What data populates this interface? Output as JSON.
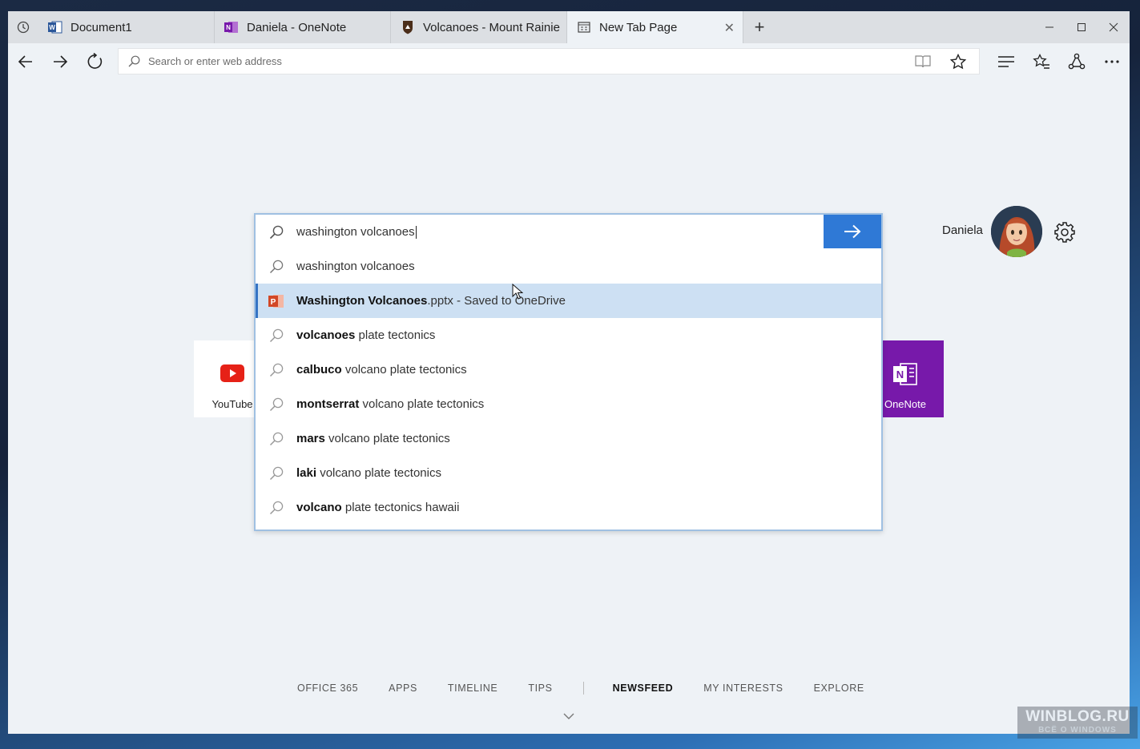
{
  "tabs": [
    {
      "title": "Document1",
      "icon": "word-icon",
      "active": false
    },
    {
      "title": "Daniela - OneNote",
      "icon": "onenote-icon",
      "active": false
    },
    {
      "title": "Volcanoes - Mount Rainie",
      "icon": "nps-icon",
      "active": false
    },
    {
      "title": "New Tab Page",
      "icon": "newtab-icon",
      "active": true
    }
  ],
  "addressbar": {
    "placeholder": "Search or enter web address"
  },
  "search": {
    "query": "washington volcanoes",
    "suggestions": [
      {
        "bold": "",
        "rest": "washington volcanoes",
        "icon": "search-icon"
      },
      {
        "bold": "Washington Volcanoes",
        "rest": ".pptx - Saved to OneDrive",
        "icon": "powerpoint-icon",
        "highlight": true
      },
      {
        "bold": "volcanoes",
        "rest": " plate tectonics",
        "icon": "search-icon"
      },
      {
        "bold": "calbuco",
        "rest": " volcano plate tectonics",
        "icon": "search-icon"
      },
      {
        "bold": "montserrat",
        "rest": " volcano plate tectonics",
        "icon": "search-icon"
      },
      {
        "bold": "mars",
        "rest": " volcano plate tectonics",
        "icon": "search-icon"
      },
      {
        "bold": "laki",
        "rest": " volcano plate tectonics",
        "icon": "search-icon"
      },
      {
        "bold": "volcano",
        "rest": " plate tectonics hawaii",
        "icon": "search-icon"
      }
    ]
  },
  "user": {
    "name": "Daniela"
  },
  "tiles": {
    "youtube": "YouTube",
    "onenote": "OneNote"
  },
  "bottom_nav": {
    "office365": "OFFICE 365",
    "apps": "APPS",
    "timeline": "TIMELINE",
    "tips": "TIPS",
    "newsfeed": "NEWSFEED",
    "interests": "MY INTERESTS",
    "explore": "EXPLORE"
  },
  "watermark": {
    "line1": "WINBLOG.RU",
    "line2": "ВСЁ О WINDOWS"
  },
  "colors": {
    "accent": "#2f79d6",
    "onenote": "#7719aa",
    "youtube": "#e62117",
    "highlight": "#cde0f3"
  }
}
